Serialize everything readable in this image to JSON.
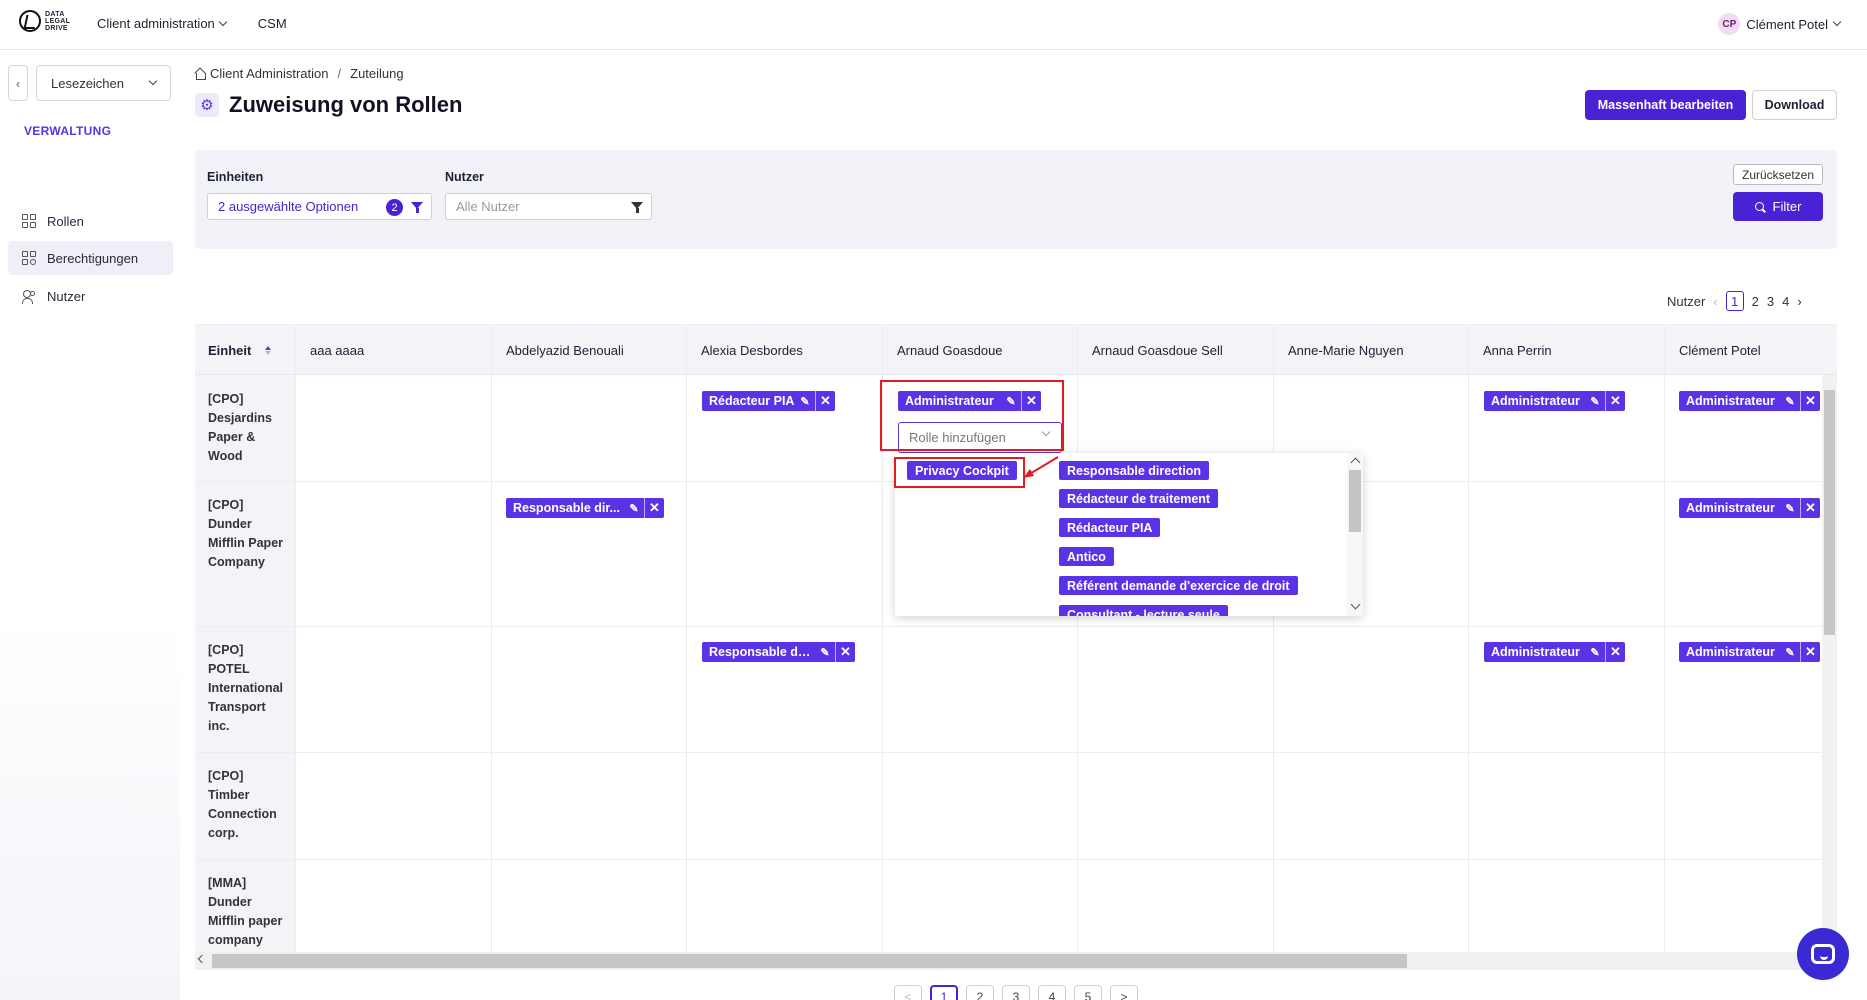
{
  "topbar": {
    "logo_lines": [
      "DATA",
      "LEGAL",
      "DRIVE"
    ],
    "nav": {
      "client_admin": "Client administration",
      "csm": "CSM"
    },
    "user": {
      "initials": "CP",
      "name": "Clément Potel"
    }
  },
  "sidebar": {
    "bookmarks_label": "Lesezeichen",
    "section": "VERWALTUNG",
    "items": [
      {
        "label": "Rollen",
        "icon": "grid-icon"
      },
      {
        "label": "Berechtigungen",
        "icon": "grid-plus-icon",
        "active": true
      },
      {
        "label": "Nutzer",
        "icon": "users-icon"
      }
    ]
  },
  "header": {
    "breadcrumb": {
      "root": "Client Administration",
      "current": "Zuteilung"
    },
    "title": "Zuweisung von Rollen",
    "bulk_edit": "Massenhaft bearbeiten",
    "download": "Download"
  },
  "filters": {
    "units_label": "Einheiten",
    "units_value": "2 ausgewählte Optionen",
    "units_count": "2",
    "users_label": "Nutzer",
    "users_placeholder": "Alle Nutzer",
    "reset": "Zurücksetzen",
    "filter": "Filter"
  },
  "pager_top": {
    "label": "Nutzer",
    "pages": [
      "1",
      "2",
      "3",
      "4"
    ],
    "current": "1"
  },
  "table": {
    "unit_header": "Einheit",
    "columns": [
      "aaa aaaa",
      "Abdelyazid Benouali",
      "Alexia Desbordes",
      "Arnaud Goasdoue",
      "Arnaud Goasdoue Sell",
      "Anne-Marie Nguyen",
      "Anna Perrin",
      "Clément Potel"
    ],
    "rows": [
      {
        "unit": "[CPO] Desjardins Paper & Wood",
        "roles": {
          "Alexia Desbordes": "Rédacteur PIA",
          "Arnaud Goasdoue": "Administrateur",
          "Anna Perrin": "Administrateur",
          "Clément Potel": "Administrateur"
        }
      },
      {
        "unit": "[CPO] Dunder Mifflin Paper Company",
        "roles": {
          "Abdelyazid Benouali": "Responsable dir...",
          "Clément Potel": "Administrateur"
        }
      },
      {
        "unit": "[CPO] POTEL International Transport inc.",
        "roles": {
          "Alexia Desbordes": "Responsable de...",
          "Anna Perrin": "Administrateur",
          "Clément Potel": "Administrateur"
        }
      },
      {
        "unit": "[CPO] Timber Connection corp.",
        "roles": {}
      },
      {
        "unit": "[MMA] Dunder Mifflin paper company",
        "roles": {}
      }
    ],
    "add_role_placeholder": "Rolle hinzufügen"
  },
  "dropdown": {
    "options": [
      "Privacy Cockpit",
      "Responsable direction",
      "Rédacteur de traitement",
      "Rédacteur PIA",
      "Antico",
      "Référent demande d'exercice de droit",
      "Consultant - lecture seule"
    ],
    "highlighted": "Privacy Cockpit"
  },
  "pager_bottom": {
    "pages": [
      "1",
      "2",
      "3",
      "4",
      "5"
    ],
    "current": "1",
    "prev": "<",
    "next": ">"
  },
  "colors": {
    "accent": "#5a33e6",
    "primary_button": "#4a22d6",
    "annotation_red": "#e31b23"
  }
}
